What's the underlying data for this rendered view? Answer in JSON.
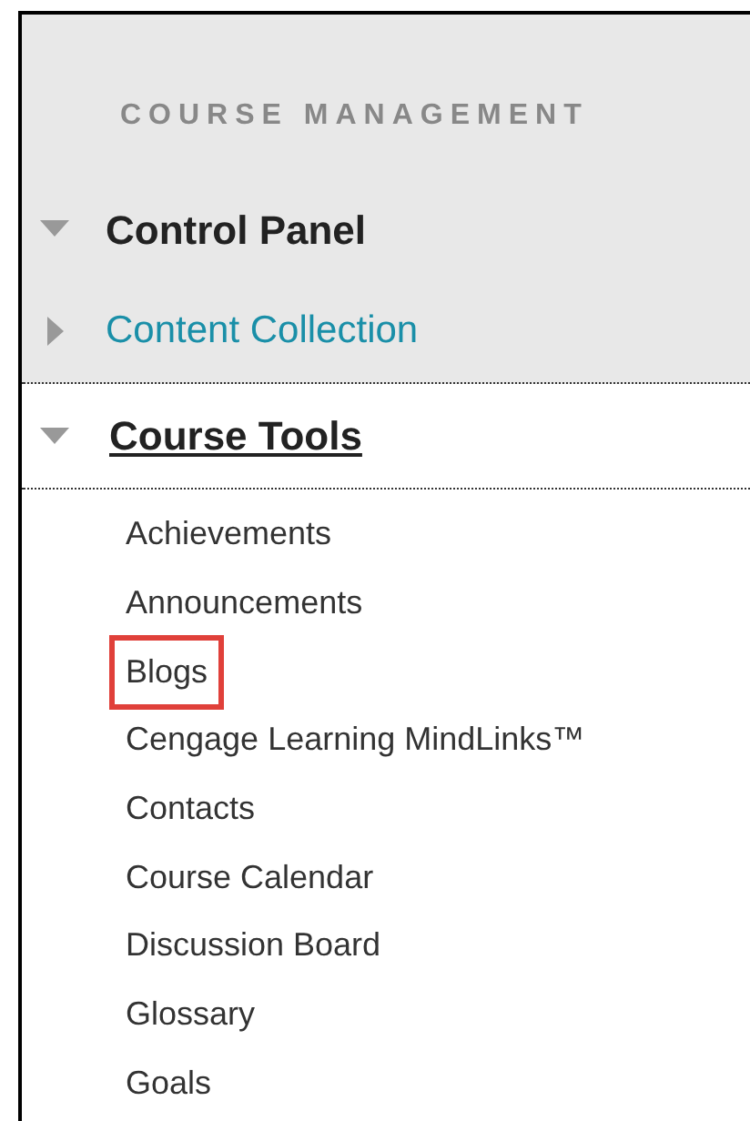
{
  "section_heading": "COURSE MANAGEMENT",
  "panels": [
    {
      "label": "Control Panel",
      "expanded": true,
      "kind": "header"
    },
    {
      "label": "Content Collection",
      "expanded": false,
      "kind": "link"
    }
  ],
  "course_tools": {
    "label": "Course Tools",
    "expanded": true,
    "items": [
      {
        "label": "Achievements",
        "highlighted": false
      },
      {
        "label": "Announcements",
        "highlighted": false
      },
      {
        "label": "Blogs",
        "highlighted": true
      },
      {
        "label": "Cengage Learning MindLinks™",
        "highlighted": false
      },
      {
        "label": "Contacts",
        "highlighted": false
      },
      {
        "label": "Course Calendar",
        "highlighted": false
      },
      {
        "label": "Discussion Board",
        "highlighted": false
      },
      {
        "label": "Glossary",
        "highlighted": false
      },
      {
        "label": "Goals",
        "highlighted": false
      }
    ]
  }
}
